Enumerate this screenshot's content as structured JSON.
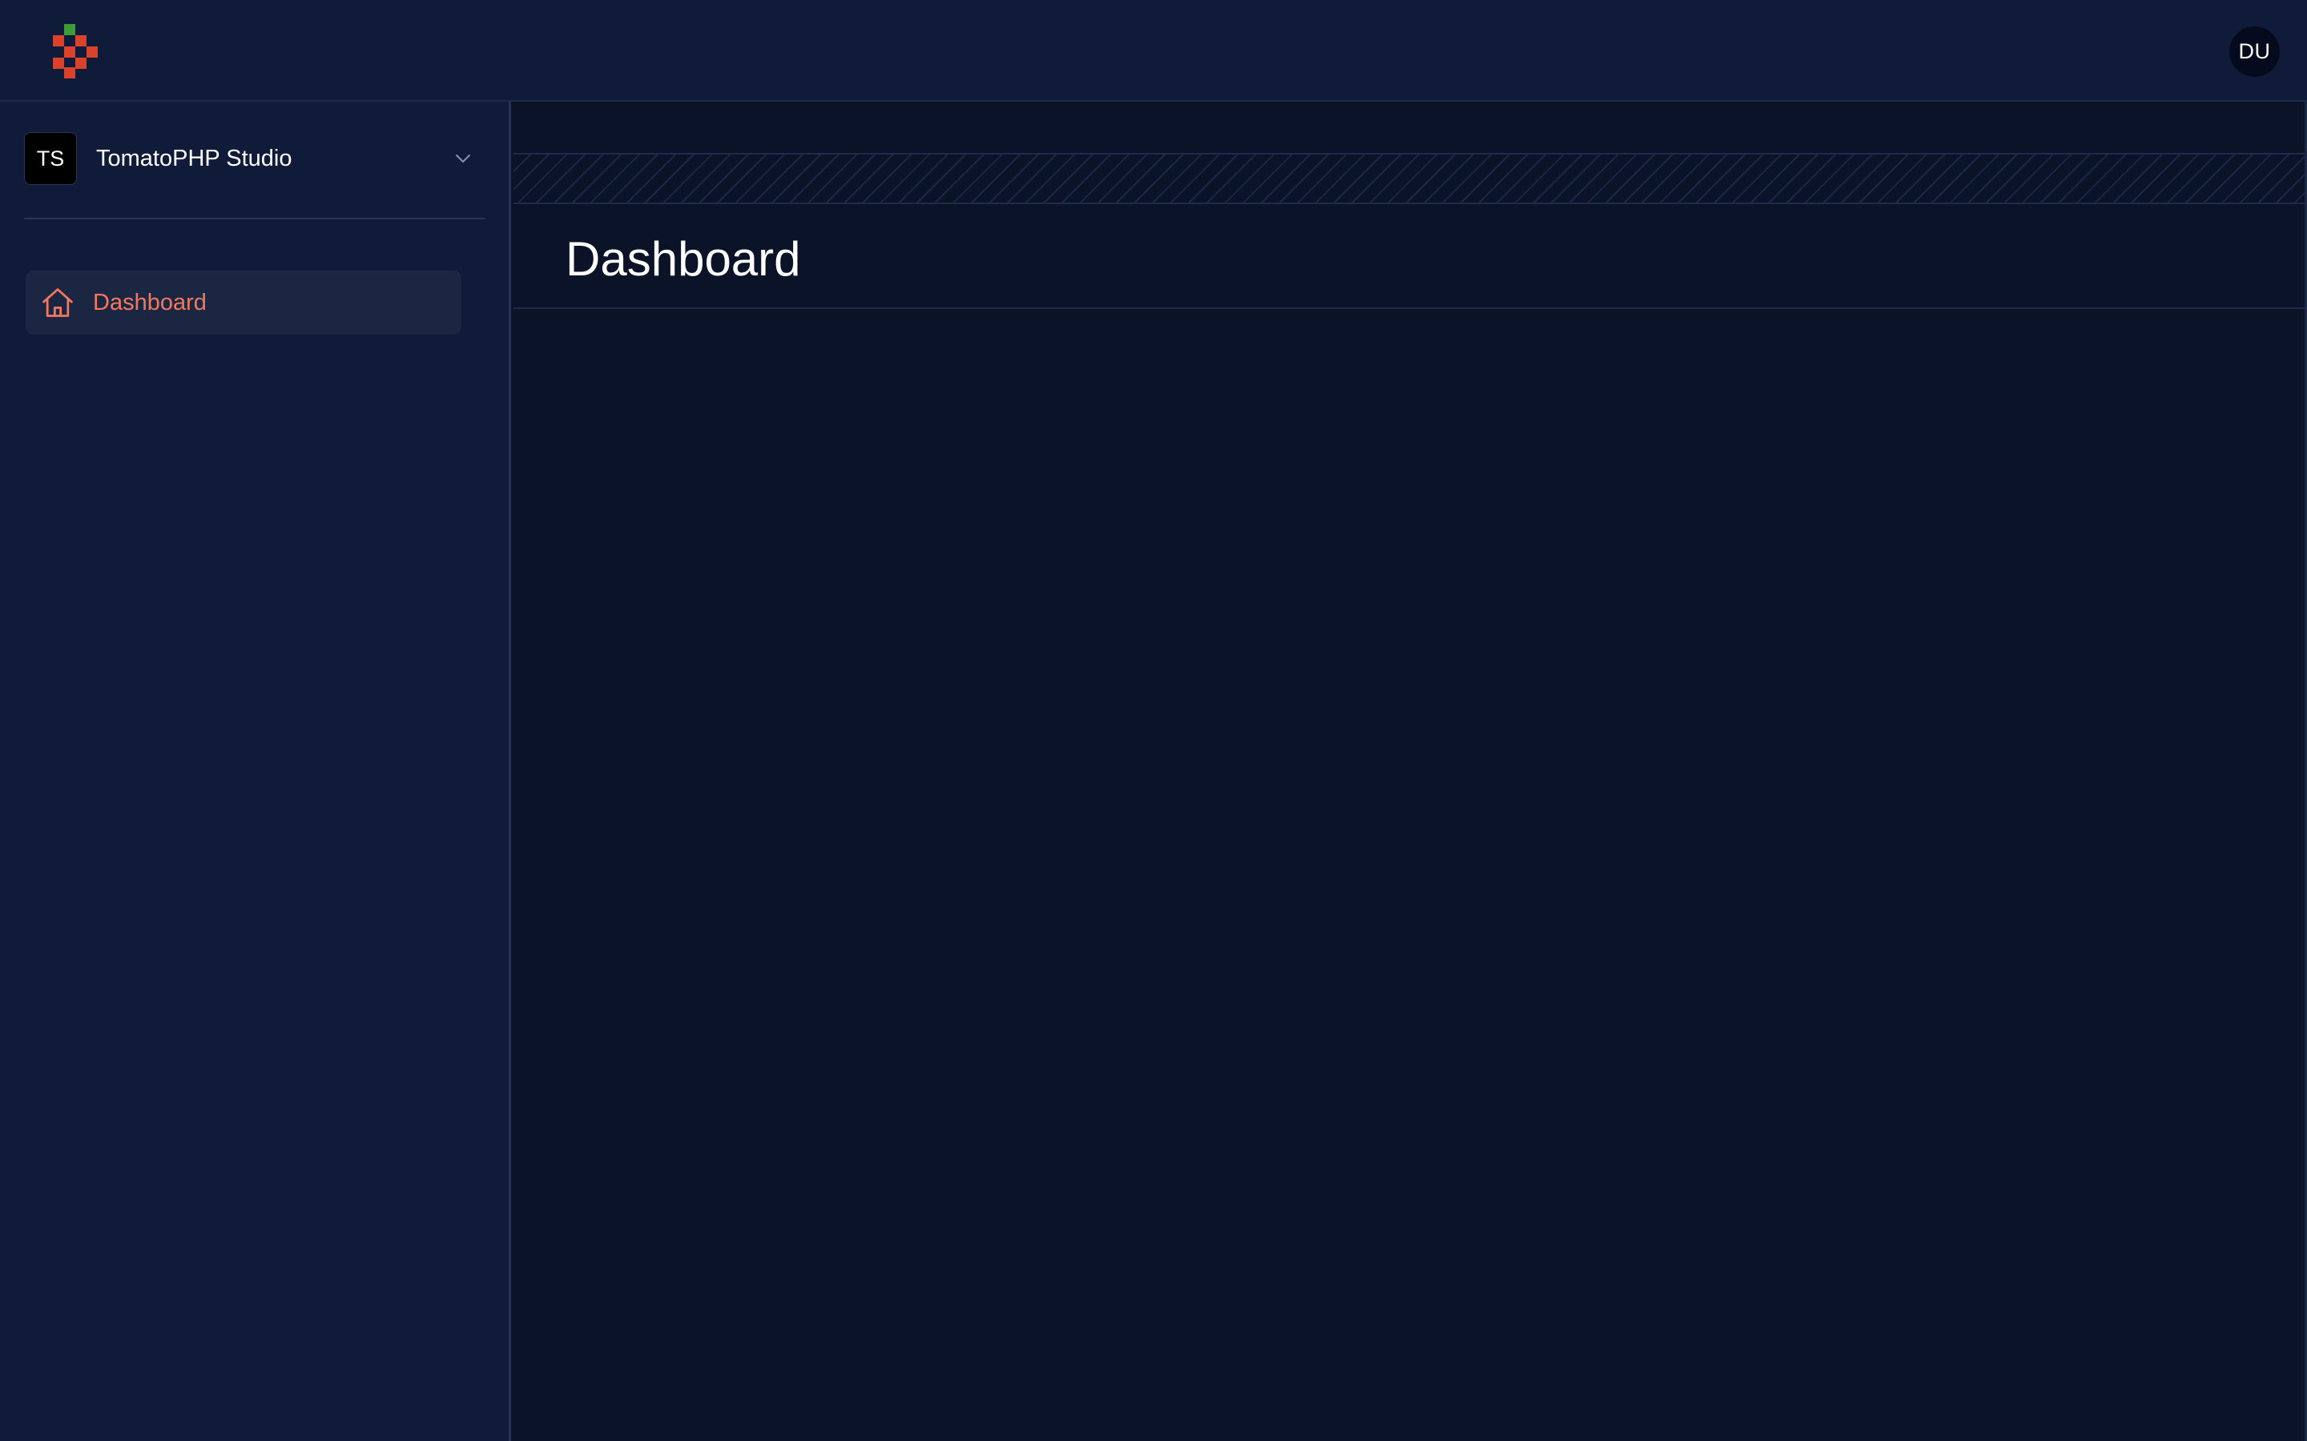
{
  "header": {
    "logo_icon": "tomato-pixel-logo",
    "user_avatar_initials": "DU"
  },
  "sidebar": {
    "team": {
      "initials": "TS",
      "name": "TomatoPHP Studio"
    },
    "items": [
      {
        "label": "Dashboard",
        "icon": "home-icon",
        "active": true
      }
    ]
  },
  "main": {
    "page_title": "Dashboard"
  },
  "colors": {
    "accent": "#f2795f",
    "logo_red": "#d9432b",
    "logo_green": "#3e9b3a",
    "background": "#0b1328",
    "panel": "#0f1b38"
  }
}
